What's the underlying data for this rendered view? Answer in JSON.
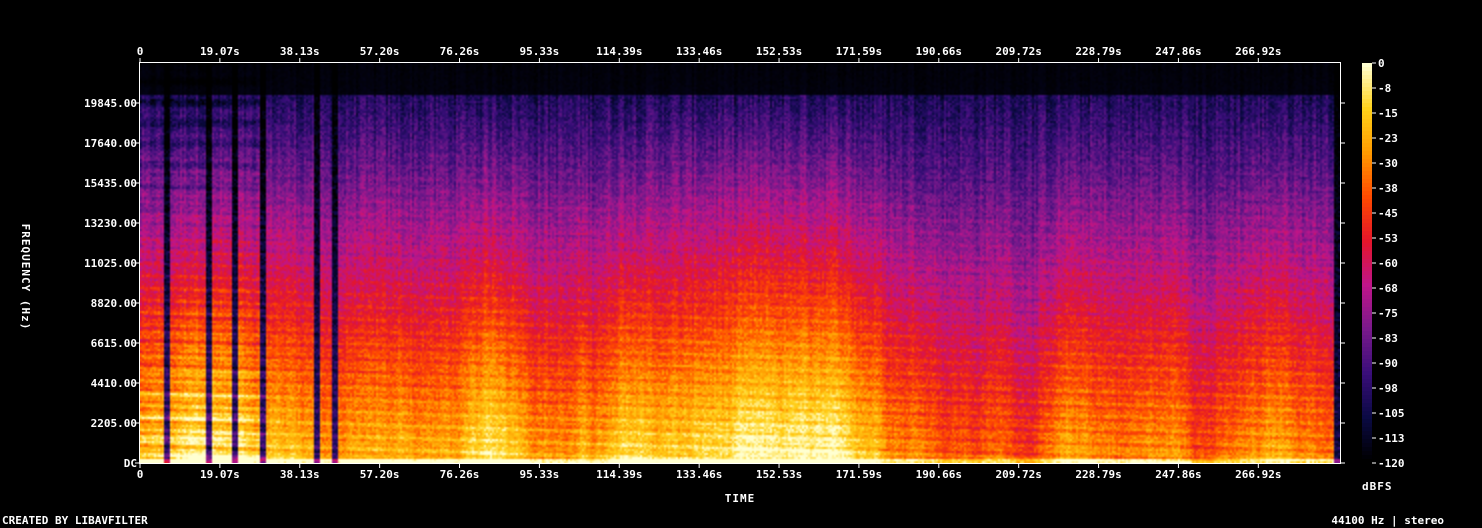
{
  "chart_data": {
    "type": "heatmap",
    "subtype": "spectrogram",
    "xlabel": "TIME",
    "ylabel": "FREQUENCY (Hz)",
    "x_ticks": [
      "0",
      "19.07s",
      "38.13s",
      "57.20s",
      "76.26s",
      "95.33s",
      "114.39s",
      "133.46s",
      "152.53s",
      "171.59s",
      "190.66s",
      "209.72s",
      "228.79s",
      "247.86s",
      "266.92s"
    ],
    "x_range_s": [
      0,
      286
    ],
    "y_ticks": [
      "DC",
      "2205.00",
      "4410.00",
      "6615.00",
      "8820.00",
      "11025.00",
      "13230.00",
      "15435.00",
      "17640.00",
      "19845.00"
    ],
    "y_range_hz": [
      0,
      22050
    ],
    "colorbar": {
      "label": "dBFS",
      "ticks": [
        "0",
        "-8",
        "-15",
        "-23",
        "-30",
        "-38",
        "-45",
        "-53",
        "-60",
        "-68",
        "-75",
        "-83",
        "-90",
        "-98",
        "-105",
        "-113",
        "-120"
      ],
      "range": [
        -120,
        0
      ]
    },
    "colormap": [
      "#000000",
      "#0b0a45",
      "#3a0e7a",
      "#7a1a8c",
      "#c0158a",
      "#e4162a",
      "#ff4a00",
      "#ff9a00",
      "#ffd21a",
      "#ffffd0"
    ]
  },
  "footer": {
    "left": "CREATED BY LIBAVFILTER",
    "right": "44100 Hz | stereo"
  }
}
